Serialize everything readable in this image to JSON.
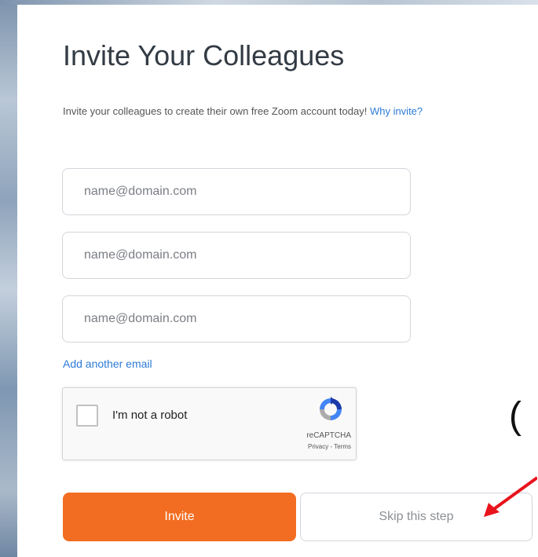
{
  "page": {
    "title": "Invite Your Colleagues",
    "subtitle_text": "Invite your colleagues to create their own free Zoom account today!",
    "why_invite_link": "Why invite?"
  },
  "emails": [
    {
      "value": "",
      "placeholder": "name@domain.com"
    },
    {
      "value": "",
      "placeholder": "name@domain.com"
    },
    {
      "value": "",
      "placeholder": "name@domain.com"
    }
  ],
  "add_email_link": "Add another email",
  "recaptcha": {
    "label": "I'm not a robot",
    "brand": "reCAPTCHA",
    "links": "Privacy - Terms",
    "checked": false
  },
  "buttons": {
    "invite": "Invite",
    "skip": "Skip this step"
  },
  "annotation": {
    "partial_glyph": "(",
    "arrow_color": "#e8141c"
  },
  "colors": {
    "accent_orange": "#f26d21",
    "link_blue": "#2d7bd6"
  }
}
